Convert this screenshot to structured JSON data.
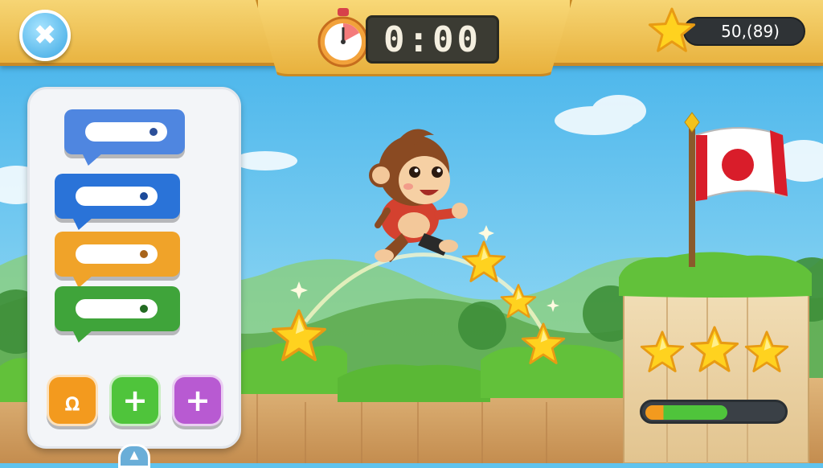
{
  "hud": {
    "timer": "0:00",
    "score_text": "50,(89)"
  },
  "icons": {
    "close": "close-icon",
    "stopwatch": "stopwatch-icon",
    "score_star": "star-icon",
    "loop_button": "loop-icon",
    "add_green": "plus-icon",
    "add_purple": "plus-icon",
    "panel_handle": "chevron-up-icon",
    "goal_flag": "flag-icon"
  },
  "code_blocks": [
    {
      "color": "#4f86e0"
    },
    {
      "color": "#2a73d8"
    },
    {
      "color": "#f0a329"
    },
    {
      "color": "#3fa43a"
    }
  ],
  "palette_buttons": [
    {
      "color": "#f39a1e"
    },
    {
      "color": "#4fc43b"
    },
    {
      "color": "#b85ad2"
    }
  ],
  "level": {
    "stars_earned": 3,
    "stars_total": 3,
    "progress_fraction": 0.6
  },
  "colors": {
    "sky": "#5fc3ee",
    "grass": "#62c13a",
    "dirt": "#d8b07a",
    "hud_gold": "#e9b441",
    "star": "#ffd21f"
  }
}
